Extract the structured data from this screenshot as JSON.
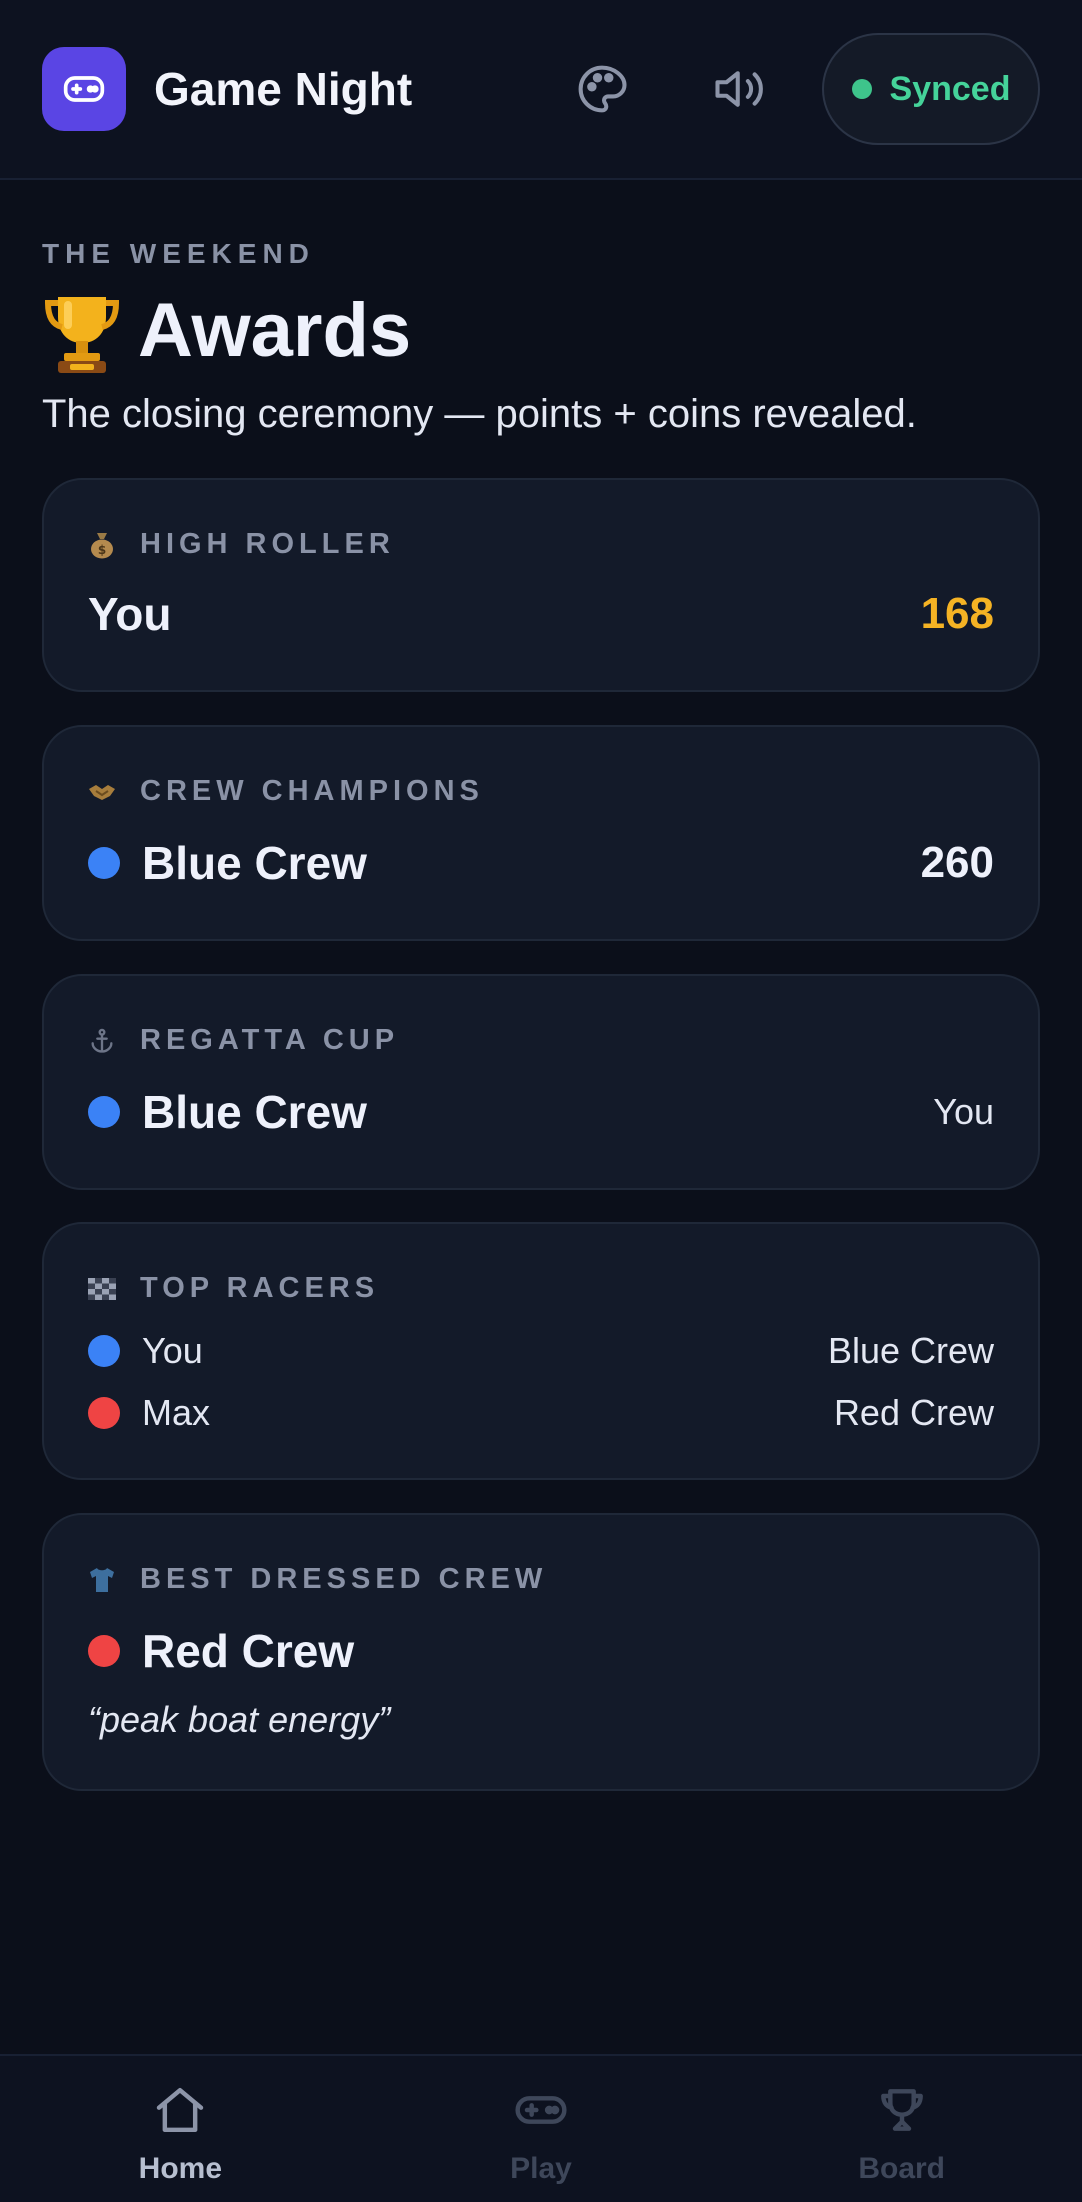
{
  "header": {
    "title": "Game Night",
    "icons": [
      "gamepad-icon",
      "palette-icon",
      "volume-icon"
    ],
    "sync_status": "Synced",
    "accent": "#5a45e4",
    "sync_color": "#45d39a"
  },
  "hero": {
    "eyebrow": "THE WEEKEND",
    "title": "Awards",
    "subtitle": "The closing ceremony — points + coins revealed."
  },
  "awards": [
    {
      "icon": "money-bag-icon",
      "label": "HIGH ROLLER",
      "winner": "You",
      "value": "168"
    },
    {
      "icon": "handshake-icon",
      "label": "CREW CHAMPIONS",
      "winner": "Blue Crew",
      "value": "260"
    },
    {
      "icon": "anchor-icon",
      "label": "REGATTA CUP",
      "winner": "Blue Crew",
      "value": "You"
    },
    {
      "icon": "checkered-flag-icon",
      "label": "TOP RACERS",
      "racers": [
        {
          "name": "You",
          "crew": "Blue Crew",
          "color": "#3b82f6"
        },
        {
          "name": "Max",
          "crew": "Red Crew",
          "color": "#ef4444"
        }
      ]
    },
    {
      "icon": "shirt-icon",
      "label": "BEST DRESSED CREW",
      "winner": "Red Crew",
      "quote": "“peak boat energy”"
    }
  ],
  "nav": {
    "items": [
      {
        "label": "Home",
        "icon": "home-icon",
        "active": true
      },
      {
        "label": "Play",
        "icon": "gamepad-icon",
        "active": false
      },
      {
        "label": "Board",
        "icon": "trophy-icon",
        "active": false
      }
    ]
  }
}
